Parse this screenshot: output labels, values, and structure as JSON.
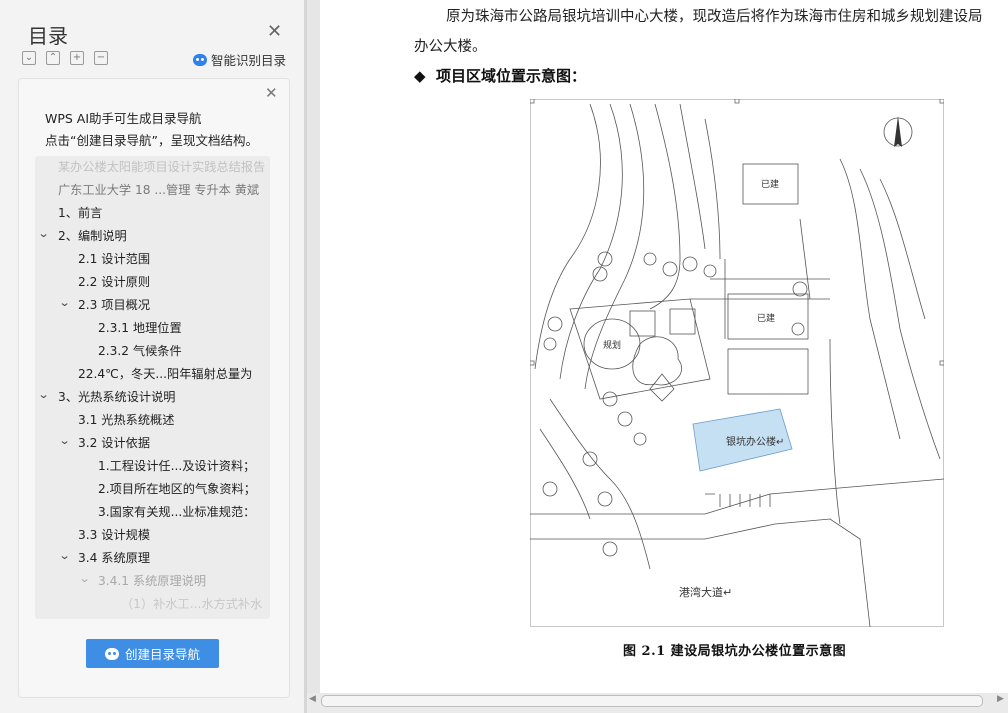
{
  "toc_panel": {
    "title": "目录",
    "smart_recognize_label": "智能识别目录",
    "ai_line1": "WPS AI助手可生成目录导航",
    "ai_line2": "点击“创建目录导航”，呈现文档结构。",
    "create_button_label": "创建目录导航",
    "items": [
      {
        "label": "某办公楼太阳能项目设计实践总结报告"
      },
      {
        "label": "广东工业大学 18 ...管理 专升本 黄斌"
      },
      {
        "label": "1、前言"
      },
      {
        "label": "2、编制说明"
      },
      {
        "label": "2.1 设计范围"
      },
      {
        "label": "2.2 设计原则"
      },
      {
        "label": "2.3 项目概况"
      },
      {
        "label": "2.3.1 地理位置"
      },
      {
        "label": "2.3.2 气候条件"
      },
      {
        "label": "22.4℃，冬天...阳年辐射总量为"
      },
      {
        "label": "3、光热系统设计说明"
      },
      {
        "label": "3.1 光热系统概述"
      },
      {
        "label": "3.2 设计依据"
      },
      {
        "label": "1.工程设计任...及设计资料；"
      },
      {
        "label": "2.项目所在地区的气象资料；"
      },
      {
        "label": "3.国家有关规...业标准规范："
      },
      {
        "label": "3.3 设计规模"
      },
      {
        "label": "3.4 系统原理"
      },
      {
        "label": "3.4.1 系统原理说明"
      },
      {
        "label": "（1）补水工...水方式补水"
      }
    ]
  },
  "document": {
    "para_line1": "原为珠海市公路局银坑培训中心大楼，现改造后将作为珠海市住房和城乡规划建设局",
    "para_line2": "办公大楼。",
    "heading_bullet": "◆",
    "heading": "项目区域位置示意图：",
    "figure": {
      "label_built1": "已建",
      "label_built2": "已建",
      "label_planned": "规划",
      "label_office": "银坑办公楼↵",
      "label_road": "港湾大道↵",
      "accent_color": "#c5dff3"
    },
    "caption": "图 2.1 建设局银坑办公楼位置示意图"
  }
}
